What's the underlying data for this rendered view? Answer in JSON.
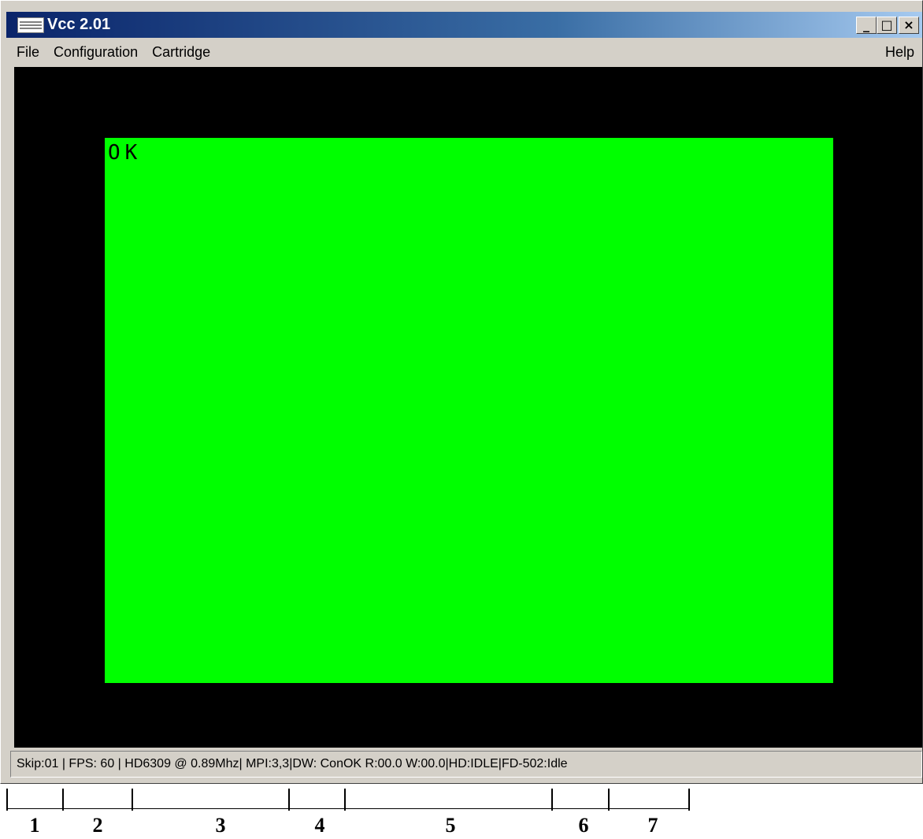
{
  "window": {
    "title": "Vcc 2.01",
    "controls": {
      "minimize": "_",
      "maximize": "□",
      "close": "×"
    }
  },
  "menubar": {
    "items": [
      "File",
      "Configuration",
      "Cartridge"
    ],
    "help": "Help"
  },
  "screen": {
    "text": "OK",
    "background_color": "#00ff00",
    "border_color": "#000000"
  },
  "statusbar": {
    "text": "Skip:01 | FPS: 60 | HD6309 @ 0.89Mhz| MPI:3,3|DW: ConOK  R:00.0 W:00.0|HD:IDLE|FD-502:Idle"
  },
  "legend": {
    "labels": [
      "1",
      "2",
      "3",
      "4",
      "5",
      "6",
      "7"
    ]
  }
}
